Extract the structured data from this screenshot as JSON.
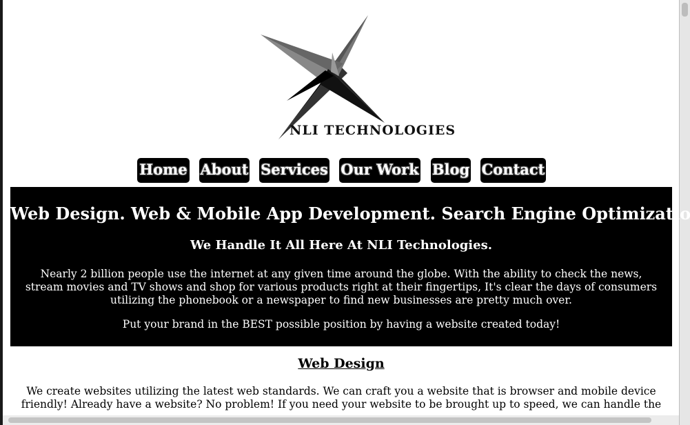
{
  "logo": {
    "icon": "star-logo-icon",
    "text": "NLI TECHNOLOGIES"
  },
  "nav": {
    "items": [
      {
        "label": "Home"
      },
      {
        "label": "About"
      },
      {
        "label": "Services"
      },
      {
        "label": "Our Work"
      },
      {
        "label": "Blog"
      },
      {
        "label": "Contact"
      }
    ]
  },
  "hero": {
    "headline": "Web Design. Web & Mobile App Development. Search Engine Optimization",
    "subheadline": "We Handle It All Here At NLI Technologies.",
    "paragraph": "Nearly 2 billion people use the internet at any given time around the globe. With the ability to check the news, stream movies and TV shows and shop for various products right at their fingertips, It's clear the days of consumers utilizing the phonebook or a newspaper to find new businesses are pretty much over.",
    "cta": "Put your brand in the BEST possible position by having a website created today!"
  },
  "web_design": {
    "title": "Web Design",
    "body": "We create websites utilizing the latest web standards. We can craft you a website that is browser and mobile device friendly! Already have a website? No problem! If you need your website to be brought up to speed, we can handle the"
  },
  "colors": {
    "nav_bg": "#000000",
    "hero_bg": "#000000",
    "page_bg": "#ffffff"
  }
}
